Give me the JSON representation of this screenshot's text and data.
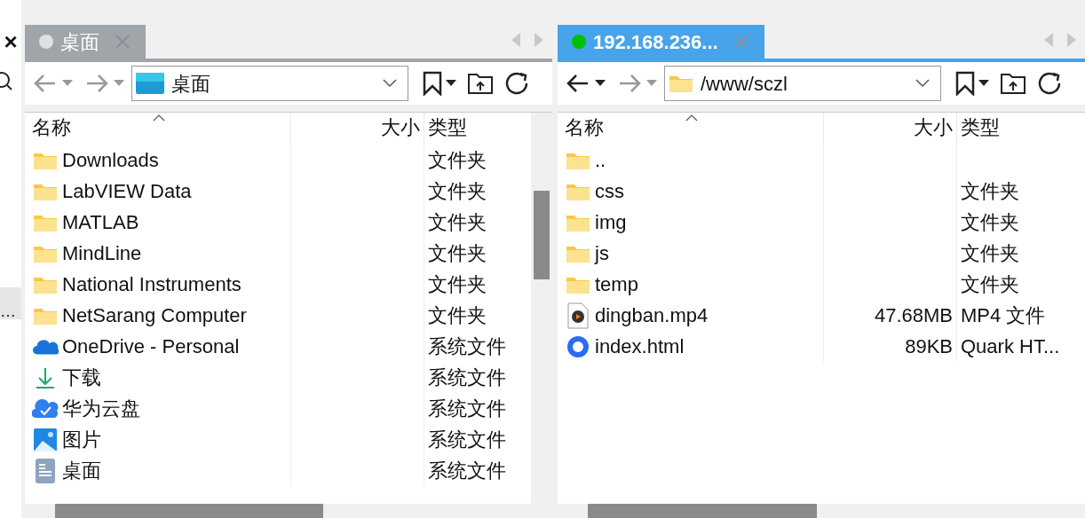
{
  "left_strip": {
    "close": "×",
    "ellipsis": "…"
  },
  "panes": [
    {
      "tab": {
        "label": "桌面",
        "selected": false,
        "connected": false
      },
      "back_enabled": false,
      "forward_enabled": false,
      "path": {
        "text": "桌面",
        "kind": "desktop"
      },
      "columns": [
        "名称",
        "大小",
        "类型"
      ],
      "vertical_scroll": true,
      "rows": [
        {
          "kind": "folder",
          "name": "Downloads",
          "type": "文件夹"
        },
        {
          "kind": "folder",
          "name": "LabVIEW Data",
          "type": "文件夹"
        },
        {
          "kind": "folder",
          "name": "MATLAB",
          "type": "文件夹"
        },
        {
          "kind": "folder",
          "name": "MindLine",
          "type": "文件夹"
        },
        {
          "kind": "folder",
          "name": "National Instruments",
          "type": "文件夹"
        },
        {
          "kind": "folder",
          "name": "NetSarang Computer",
          "type": "文件夹"
        },
        {
          "kind": "onedrive",
          "name": "OneDrive - Personal",
          "type": "系统文件"
        },
        {
          "kind": "download",
          "name": "下载",
          "type": "系统文件"
        },
        {
          "kind": "cloud",
          "name": "华为云盘",
          "type": "系统文件"
        },
        {
          "kind": "pictures",
          "name": "图片",
          "type": "系统文件"
        },
        {
          "kind": "document",
          "name": "桌面",
          "type": "系统文件"
        }
      ]
    },
    {
      "tab": {
        "label": "192.168.236...",
        "selected": true,
        "connected": true
      },
      "back_enabled": true,
      "forward_enabled": false,
      "path": {
        "text": "/www/sczl",
        "kind": "folder"
      },
      "columns": [
        "名称",
        "大小",
        "类型"
      ],
      "vertical_scroll": false,
      "rows": [
        {
          "kind": "folder",
          "name": ".."
        },
        {
          "kind": "folder",
          "name": "css",
          "type": "文件夹"
        },
        {
          "kind": "folder",
          "name": "img",
          "type": "文件夹"
        },
        {
          "kind": "folder",
          "name": "js",
          "type": "文件夹"
        },
        {
          "kind": "folder",
          "name": "temp",
          "type": "文件夹"
        },
        {
          "kind": "video",
          "name": "dingban.mp4",
          "size": "47.68MB",
          "type": "MP4 文件"
        },
        {
          "kind": "html",
          "name": "index.html",
          "size": "89KB",
          "type": "Quark HT..."
        }
      ]
    }
  ]
}
